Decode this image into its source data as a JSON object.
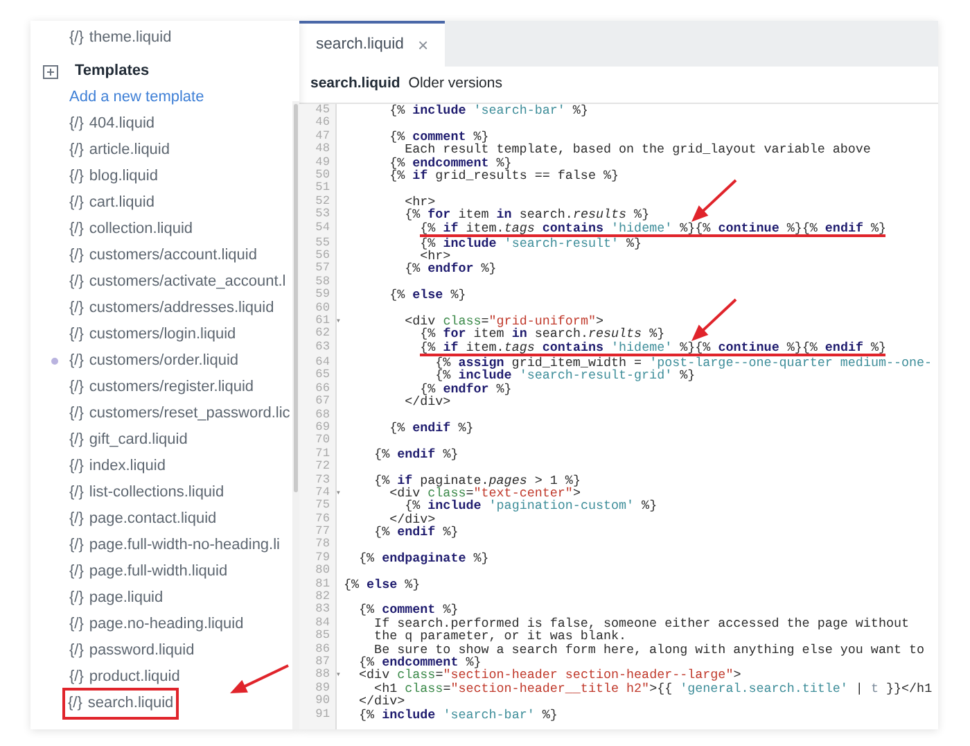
{
  "sidebar": {
    "items": [
      {
        "kind": "file",
        "icon": "{/}",
        "label": "theme.liquid"
      },
      {
        "kind": "folder",
        "label": "Templates"
      },
      {
        "kind": "link",
        "label": "Add a new template"
      },
      {
        "kind": "file",
        "icon": "{/}",
        "label": "404.liquid"
      },
      {
        "kind": "file",
        "icon": "{/}",
        "label": "article.liquid"
      },
      {
        "kind": "file",
        "icon": "{/}",
        "label": "blog.liquid"
      },
      {
        "kind": "file",
        "icon": "{/}",
        "label": "cart.liquid"
      },
      {
        "kind": "file",
        "icon": "{/}",
        "label": "collection.liquid"
      },
      {
        "kind": "file",
        "icon": "{/}",
        "label": "customers/account.liquid"
      },
      {
        "kind": "file",
        "icon": "{/}",
        "label": "customers/activate_account.l"
      },
      {
        "kind": "file",
        "icon": "{/}",
        "label": "customers/addresses.liquid"
      },
      {
        "kind": "file",
        "icon": "{/}",
        "label": "customers/login.liquid"
      },
      {
        "kind": "file",
        "icon": "{/}",
        "label": "customers/order.liquid",
        "modified": true
      },
      {
        "kind": "file",
        "icon": "{/}",
        "label": "customers/register.liquid"
      },
      {
        "kind": "file",
        "icon": "{/}",
        "label": "customers/reset_password.lic"
      },
      {
        "kind": "file",
        "icon": "{/}",
        "label": "gift_card.liquid"
      },
      {
        "kind": "file",
        "icon": "{/}",
        "label": "index.liquid"
      },
      {
        "kind": "file",
        "icon": "{/}",
        "label": "list-collections.liquid"
      },
      {
        "kind": "file",
        "icon": "{/}",
        "label": "page.contact.liquid"
      },
      {
        "kind": "file",
        "icon": "{/}",
        "label": "page.full-width-no-heading.li"
      },
      {
        "kind": "file",
        "icon": "{/}",
        "label": "page.full-width.liquid"
      },
      {
        "kind": "file",
        "icon": "{/}",
        "label": "page.liquid"
      },
      {
        "kind": "file",
        "icon": "{/}",
        "label": "page.no-heading.liquid"
      },
      {
        "kind": "file",
        "icon": "{/}",
        "label": "password.liquid"
      },
      {
        "kind": "file",
        "icon": "{/}",
        "label": "product.liquid"
      },
      {
        "kind": "file",
        "icon": "{/}",
        "label": "search.liquid",
        "annotated": true
      }
    ]
  },
  "editor": {
    "tabs": [
      {
        "label": "search.liquid",
        "close": "×",
        "selected": true
      }
    ],
    "file_title": "search.liquid",
    "history_link": "Older versions",
    "lines": [
      {
        "number": "45",
        "tokens": [
          {
            "kind": "plain",
            "text": "      {% "
          },
          {
            "kind": "keyword",
            "text": "include"
          },
          {
            "kind": "string",
            "text": " 'search-bar'"
          },
          {
            "kind": "plain",
            "text": " %}"
          }
        ]
      },
      {
        "number": "46"
      },
      {
        "number": "47",
        "tokens": [
          {
            "kind": "plain",
            "text": "      {% "
          },
          {
            "kind": "keyword",
            "text": "comment"
          },
          {
            "kind": "plain",
            "text": " %}"
          }
        ]
      },
      {
        "number": "48",
        "tokens": [
          {
            "kind": "plain",
            "text": "        Each result template, based on the grid_layout variable above"
          }
        ]
      },
      {
        "number": "49",
        "tokens": [
          {
            "kind": "plain",
            "text": "      {% "
          },
          {
            "kind": "keyword",
            "text": "endcomment"
          },
          {
            "kind": "plain",
            "text": " %}"
          }
        ]
      },
      {
        "number": "50",
        "tokens": [
          {
            "kind": "plain",
            "text": "      {% "
          },
          {
            "kind": "keyword",
            "text": "if"
          },
          {
            "kind": "plain",
            "text": " grid_results == false %}"
          }
        ]
      },
      {
        "number": "51"
      },
      {
        "number": "52",
        "tokens": [
          {
            "kind": "plain",
            "text": "        <hr>"
          }
        ]
      },
      {
        "number": "53",
        "tokens": [
          {
            "kind": "plain",
            "text": "        {% "
          },
          {
            "kind": "keyword",
            "text": "for"
          },
          {
            "kind": "plain",
            "text": " item "
          },
          {
            "kind": "keyword",
            "text": "in"
          },
          {
            "kind": "plain",
            "text": " search."
          },
          {
            "kind": "property",
            "text": "results"
          },
          {
            "kind": "plain",
            "text": " %}"
          }
        ]
      },
      {
        "number": "54",
        "annotated": true,
        "tokens": [
          {
            "kind": "plain",
            "text": "          {% "
          },
          {
            "kind": "keyword",
            "text": "if"
          },
          {
            "kind": "plain",
            "text": " item."
          },
          {
            "kind": "property",
            "text": "tags"
          },
          {
            "kind": "keyword",
            "text": " contains"
          },
          {
            "kind": "string",
            "text": " 'hideme'"
          },
          {
            "kind": "plain",
            "text": " %}{% "
          },
          {
            "kind": "keyword",
            "text": "continue"
          },
          {
            "kind": "plain",
            "text": " %}{% "
          },
          {
            "kind": "keyword",
            "text": "endif"
          },
          {
            "kind": "plain",
            "text": " %}"
          }
        ]
      },
      {
        "number": "55",
        "tokens": [
          {
            "kind": "plain",
            "text": "          {% "
          },
          {
            "kind": "keyword",
            "text": "include"
          },
          {
            "kind": "string",
            "text": " 'search-result'"
          },
          {
            "kind": "plain",
            "text": " %}"
          }
        ]
      },
      {
        "number": "56",
        "tokens": [
          {
            "kind": "plain",
            "text": "          <hr>"
          }
        ]
      },
      {
        "number": "57",
        "tokens": [
          {
            "kind": "plain",
            "text": "        {% "
          },
          {
            "kind": "keyword",
            "text": "endfor"
          },
          {
            "kind": "plain",
            "text": " %}"
          }
        ]
      },
      {
        "number": "58"
      },
      {
        "number": "59",
        "tokens": [
          {
            "kind": "plain",
            "text": "      {% "
          },
          {
            "kind": "keyword",
            "text": "else"
          },
          {
            "kind": "plain",
            "text": " %}"
          }
        ]
      },
      {
        "number": "60"
      },
      {
        "number": "61",
        "fold": "▾",
        "tokens": [
          {
            "kind": "plain",
            "text": "        <div "
          },
          {
            "kind": "attribute",
            "text": "class"
          },
          {
            "kind": "plain",
            "text": "="
          },
          {
            "kind": "value",
            "text": "\"grid-uniform\""
          },
          {
            "kind": "plain",
            "text": ">"
          }
        ]
      },
      {
        "number": "62",
        "tokens": [
          {
            "kind": "plain",
            "text": "          {% "
          },
          {
            "kind": "keyword",
            "text": "for"
          },
          {
            "kind": "plain",
            "text": " item "
          },
          {
            "kind": "keyword",
            "text": "in"
          },
          {
            "kind": "plain",
            "text": " search."
          },
          {
            "kind": "property",
            "text": "results"
          },
          {
            "kind": "plain",
            "text": " %}"
          }
        ]
      },
      {
        "number": "63",
        "annotated": true,
        "tokens": [
          {
            "kind": "plain",
            "text": "          {% "
          },
          {
            "kind": "keyword",
            "text": "if"
          },
          {
            "kind": "plain",
            "text": " item."
          },
          {
            "kind": "property",
            "text": "tags"
          },
          {
            "kind": "keyword",
            "text": " contains"
          },
          {
            "kind": "string",
            "text": " 'hideme'"
          },
          {
            "kind": "plain",
            "text": " %}{% "
          },
          {
            "kind": "keyword",
            "text": "continue"
          },
          {
            "kind": "plain",
            "text": " %}{% "
          },
          {
            "kind": "keyword",
            "text": "endif"
          },
          {
            "kind": "plain",
            "text": " %}"
          }
        ]
      },
      {
        "number": "64",
        "tokens": [
          {
            "kind": "plain",
            "text": "            {% "
          },
          {
            "kind": "keyword",
            "text": "assign"
          },
          {
            "kind": "plain",
            "text": " grid_item_width = "
          },
          {
            "kind": "string",
            "text": "'post-large--one-quarter medium--one-"
          }
        ]
      },
      {
        "number": "65",
        "tokens": [
          {
            "kind": "plain",
            "text": "            {% "
          },
          {
            "kind": "keyword",
            "text": "include"
          },
          {
            "kind": "string",
            "text": " 'search-result-grid'"
          },
          {
            "kind": "plain",
            "text": " %}"
          }
        ]
      },
      {
        "number": "66",
        "tokens": [
          {
            "kind": "plain",
            "text": "          {% "
          },
          {
            "kind": "keyword",
            "text": "endfor"
          },
          {
            "kind": "plain",
            "text": " %}"
          }
        ]
      },
      {
        "number": "67",
        "tokens": [
          {
            "kind": "plain",
            "text": "        </div>"
          }
        ]
      },
      {
        "number": "68"
      },
      {
        "number": "69",
        "tokens": [
          {
            "kind": "plain",
            "text": "      {% "
          },
          {
            "kind": "keyword",
            "text": "endif"
          },
          {
            "kind": "plain",
            "text": " %}"
          }
        ]
      },
      {
        "number": "70"
      },
      {
        "number": "71",
        "tokens": [
          {
            "kind": "plain",
            "text": "    {% "
          },
          {
            "kind": "keyword",
            "text": "endif"
          },
          {
            "kind": "plain",
            "text": " %}"
          }
        ]
      },
      {
        "number": "72"
      },
      {
        "number": "73",
        "tokens": [
          {
            "kind": "plain",
            "text": "    {% "
          },
          {
            "kind": "keyword",
            "text": "if"
          },
          {
            "kind": "plain",
            "text": " paginate."
          },
          {
            "kind": "property",
            "text": "pages"
          },
          {
            "kind": "plain",
            "text": " > 1 %}"
          }
        ]
      },
      {
        "number": "74",
        "fold": "▾",
        "tokens": [
          {
            "kind": "plain",
            "text": "      <div "
          },
          {
            "kind": "attribute",
            "text": "class"
          },
          {
            "kind": "plain",
            "text": "="
          },
          {
            "kind": "value",
            "text": "\"text-center\""
          },
          {
            "kind": "plain",
            "text": ">"
          }
        ]
      },
      {
        "number": "75",
        "tokens": [
          {
            "kind": "plain",
            "text": "        {% "
          },
          {
            "kind": "keyword",
            "text": "include"
          },
          {
            "kind": "string",
            "text": " 'pagination-custom'"
          },
          {
            "kind": "plain",
            "text": " %}"
          }
        ]
      },
      {
        "number": "76",
        "tokens": [
          {
            "kind": "plain",
            "text": "      </div>"
          }
        ]
      },
      {
        "number": "77",
        "tokens": [
          {
            "kind": "plain",
            "text": "    {% "
          },
          {
            "kind": "keyword",
            "text": "endif"
          },
          {
            "kind": "plain",
            "text": " %}"
          }
        ]
      },
      {
        "number": "78"
      },
      {
        "number": "79",
        "tokens": [
          {
            "kind": "plain",
            "text": "  {% "
          },
          {
            "kind": "keyword",
            "text": "endpaginate"
          },
          {
            "kind": "plain",
            "text": " %}"
          }
        ]
      },
      {
        "number": "80"
      },
      {
        "number": "81",
        "tokens": [
          {
            "kind": "plain",
            "text": "{% "
          },
          {
            "kind": "keyword",
            "text": "else"
          },
          {
            "kind": "plain",
            "text": " %}"
          }
        ]
      },
      {
        "number": "82"
      },
      {
        "number": "83",
        "tokens": [
          {
            "kind": "plain",
            "text": "  {% "
          },
          {
            "kind": "keyword",
            "text": "comment"
          },
          {
            "kind": "plain",
            "text": " %}"
          }
        ]
      },
      {
        "number": "84",
        "tokens": [
          {
            "kind": "plain",
            "text": "    If search.performed is false, someone either accessed the page without"
          }
        ]
      },
      {
        "number": "85",
        "tokens": [
          {
            "kind": "plain",
            "text": "    the q parameter, or it was blank."
          }
        ]
      },
      {
        "number": "86",
        "tokens": [
          {
            "kind": "plain",
            "text": "    Be sure to show a search form here, along with anything else you want to"
          }
        ]
      },
      {
        "number": "87",
        "tokens": [
          {
            "kind": "plain",
            "text": "  {% "
          },
          {
            "kind": "keyword",
            "text": "endcomment"
          },
          {
            "kind": "plain",
            "text": " %}"
          }
        ]
      },
      {
        "number": "88",
        "fold": "▾",
        "tokens": [
          {
            "kind": "plain",
            "text": "  <div "
          },
          {
            "kind": "attribute",
            "text": "class"
          },
          {
            "kind": "plain",
            "text": "="
          },
          {
            "kind": "value",
            "text": "\"section-header section-header--large\""
          },
          {
            "kind": "plain",
            "text": ">"
          }
        ]
      },
      {
        "number": "89",
        "tokens": [
          {
            "kind": "plain",
            "text": "    <h1 "
          },
          {
            "kind": "attribute",
            "text": "class"
          },
          {
            "kind": "plain",
            "text": "="
          },
          {
            "kind": "value",
            "text": "\"section-header__title h2\""
          },
          {
            "kind": "plain",
            "text": ">{{ "
          },
          {
            "kind": "string",
            "text": "'general.search.title'"
          },
          {
            "kind": "plain",
            "text": " | "
          },
          {
            "kind": "filter",
            "text": "t"
          },
          {
            "kind": "plain",
            "text": " }}</h1"
          }
        ]
      },
      {
        "number": "90",
        "tokens": [
          {
            "kind": "plain",
            "text": "  </div>"
          }
        ]
      },
      {
        "number": "91",
        "tokens": [
          {
            "kind": "plain",
            "text": "  {% "
          },
          {
            "kind": "keyword",
            "text": "include"
          },
          {
            "kind": "string",
            "text": " 'search-bar'"
          },
          {
            "kind": "plain",
            "text": " %}"
          }
        ]
      }
    ]
  }
}
